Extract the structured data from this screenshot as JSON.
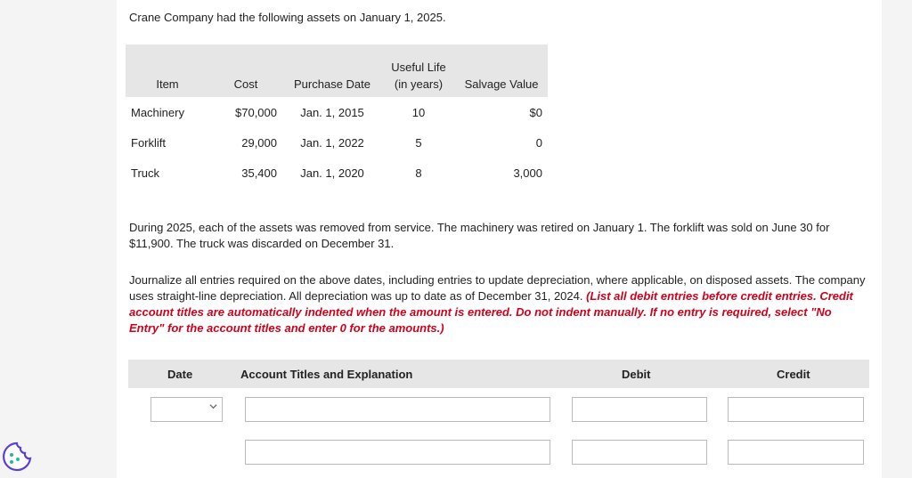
{
  "intro": "Crane Company had the following assets on January 1, 2025.",
  "asset_table": {
    "headers": {
      "item": "Item",
      "cost": "Cost",
      "purchase_date": "Purchase Date",
      "useful_life_line1": "Useful Life",
      "useful_life_line2": "(in years)",
      "salvage": "Salvage Value"
    },
    "rows": [
      {
        "item": "Machinery",
        "cost": "$70,000",
        "purchase_date": "Jan. 1, 2015",
        "useful_life": "10",
        "salvage": "$0"
      },
      {
        "item": "Forklift",
        "cost": "29,000",
        "purchase_date": "Jan. 1, 2022",
        "useful_life": "5",
        "salvage": "0"
      },
      {
        "item": "Truck",
        "cost": "35,400",
        "purchase_date": "Jan. 1, 2020",
        "useful_life": "8",
        "salvage": "3,000"
      }
    ]
  },
  "paragraph1": "During 2025, each of the assets was removed from service. The machinery was retired on January 1. The forklift was sold on June 30 for $11,900. The truck was discarded on December 31.",
  "paragraph2_plain": "Journalize all entries required on the above dates, including entries to update depreciation, where applicable, on disposed assets. The company uses straight-line depreciation. All depreciation was up to date as of December 31, 2024. ",
  "paragraph2_instruction": "(List all debit entries before credit entries. Credit account titles are automatically indented when the amount is entered. Do not indent manually. If no entry is required, select \"No Entry\" for the account titles and enter 0 for the amounts.)",
  "journal": {
    "headers": {
      "date": "Date",
      "account": "Account Titles and Explanation",
      "debit": "Debit",
      "credit": "Credit"
    },
    "rows": [
      {
        "date": "",
        "account": "",
        "debit": "",
        "credit": ""
      },
      {
        "account": "",
        "debit": "",
        "credit": ""
      }
    ]
  },
  "icons": {
    "chevron": "chevron-down-icon",
    "cookie": "cookie-icon"
  },
  "colors": {
    "instruction_red": "#d0021b",
    "cookie_purple": "#5b3fd6"
  }
}
